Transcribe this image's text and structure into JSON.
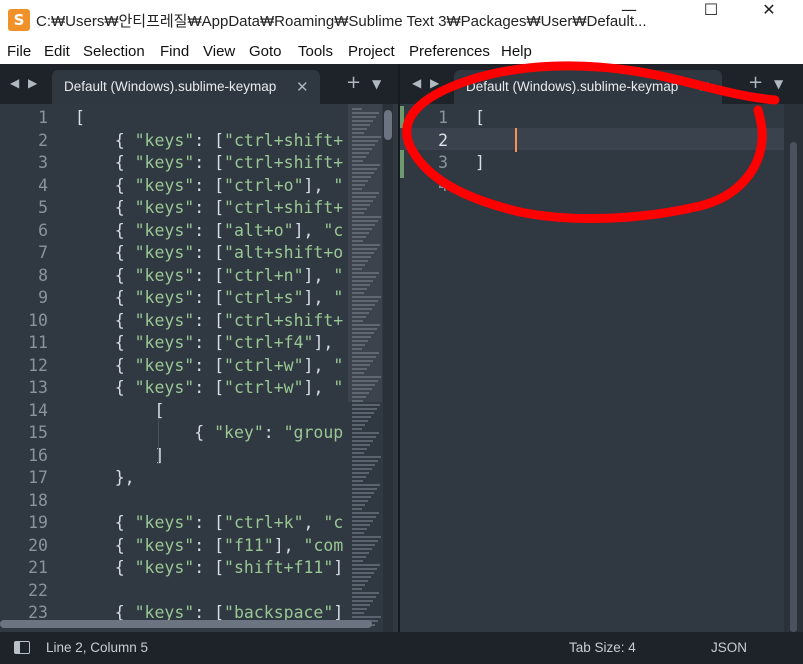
{
  "window": {
    "title": "C:₩Users₩안티프레질₩AppData₩Roaming₩Sublime Text 3₩Packages₩User₩Default...",
    "app_icon": "S",
    "minimize": "—",
    "maximize": "☐",
    "close": "✕"
  },
  "menu": [
    "File",
    "Edit",
    "Selection",
    "Find",
    "View",
    "Goto",
    "Tools",
    "Project",
    "Preferences",
    "Help"
  ],
  "left_pane": {
    "tab_label": "Default (Windows).sublime-keymap",
    "tab_close": "✕",
    "lines": [
      {
        "n": "1",
        "text": "["
      },
      {
        "n": "2",
        "text": "    { \"keys\": [\"ctrl+shift+"
      },
      {
        "n": "3",
        "text": "    { \"keys\": [\"ctrl+shift+"
      },
      {
        "n": "4",
        "text": "    { \"keys\": [\"ctrl+o\"], \""
      },
      {
        "n": "5",
        "text": "    { \"keys\": [\"ctrl+shift+"
      },
      {
        "n": "6",
        "text": "    { \"keys\": [\"alt+o\"], \"c"
      },
      {
        "n": "7",
        "text": "    { \"keys\": [\"alt+shift+o"
      },
      {
        "n": "8",
        "text": "    { \"keys\": [\"ctrl+n\"], \""
      },
      {
        "n": "9",
        "text": "    { \"keys\": [\"ctrl+s\"], \""
      },
      {
        "n": "10",
        "text": "    { \"keys\": [\"ctrl+shift+"
      },
      {
        "n": "11",
        "text": "    { \"keys\": [\"ctrl+f4\"], "
      },
      {
        "n": "12",
        "text": "    { \"keys\": [\"ctrl+w\"], \""
      },
      {
        "n": "13",
        "text": "    { \"keys\": [\"ctrl+w\"], \""
      },
      {
        "n": "14",
        "text": "        ["
      },
      {
        "n": "15",
        "text": "            { \"key\": \"group"
      },
      {
        "n": "16",
        "text": "        ]"
      },
      {
        "n": "17",
        "text": "    },"
      },
      {
        "n": "18",
        "text": ""
      },
      {
        "n": "19",
        "text": "    { \"keys\": [\"ctrl+k\", \"c"
      },
      {
        "n": "20",
        "text": "    { \"keys\": [\"f11\"], \"com"
      },
      {
        "n": "21",
        "text": "    { \"keys\": [\"shift+f11\"]"
      },
      {
        "n": "22",
        "text": ""
      },
      {
        "n": "23",
        "text": "    { \"keys\": [\"backspace\"]"
      }
    ]
  },
  "right_pane": {
    "tab_label": "Default (Windows).sublime-keymap",
    "tab_close": "✕",
    "lines": [
      {
        "n": "1",
        "text": "["
      },
      {
        "n": "2",
        "text": ""
      },
      {
        "n": "3",
        "text": "]"
      },
      {
        "n": "4",
        "text": ""
      }
    ],
    "active_line": "2"
  },
  "tab_controls": {
    "prev": "◀",
    "next": "▶",
    "plus": "+",
    "down": "▼"
  },
  "status": {
    "position": "Line 2, Column 5",
    "tab_size": "Tab Size: 4",
    "syntax": "JSON"
  },
  "colors": {
    "annotation": "#ff0000",
    "caret": "#f99157",
    "string": "#99c794"
  }
}
